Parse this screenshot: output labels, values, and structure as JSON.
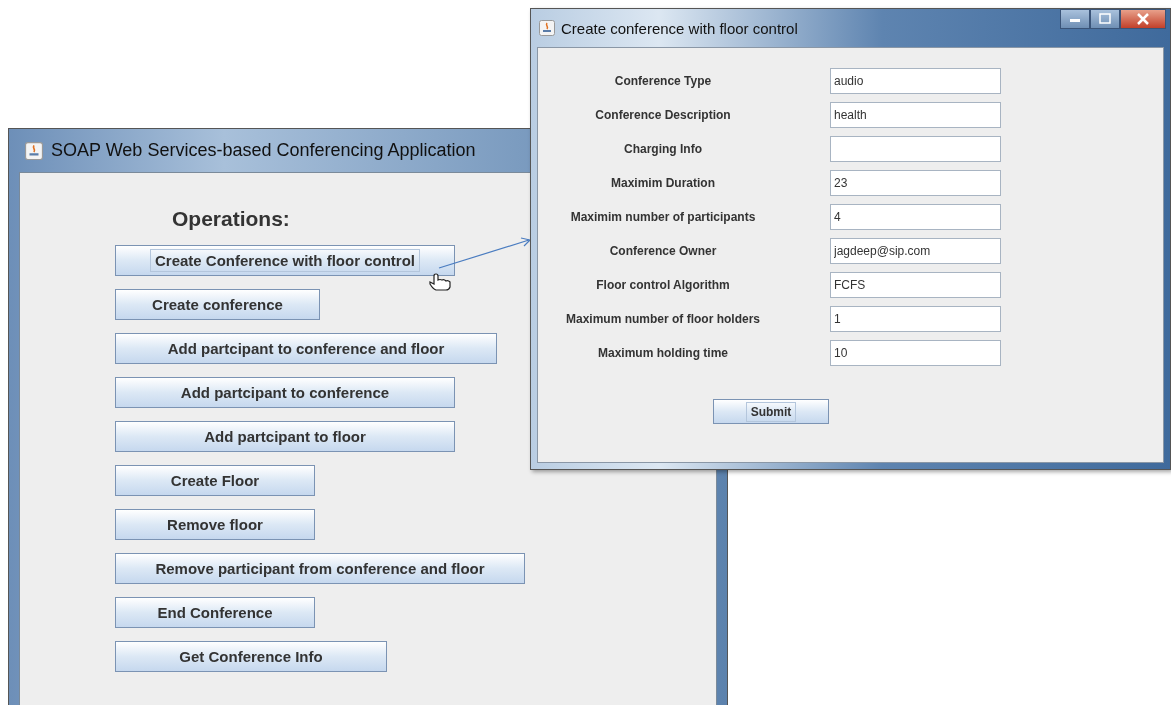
{
  "main_window": {
    "title": "SOAP Web Services-based Conferencing Application",
    "heading": "Operations:",
    "buttons": [
      {
        "label": "Create Conference with floor control",
        "focused": true
      },
      {
        "label": "Create conference",
        "focused": false
      },
      {
        "label": "Add partcipant to conference and floor",
        "focused": false
      },
      {
        "label": "Add partcipant to conference",
        "focused": false
      },
      {
        "label": "Add partcipant to floor",
        "focused": false
      },
      {
        "label": "Create Floor",
        "focused": false
      },
      {
        "label": "Remove floor",
        "focused": false
      },
      {
        "label": "Remove participant from conference and floor",
        "focused": false
      },
      {
        "label": "End Conference",
        "focused": false
      },
      {
        "label": "Get Conference Info",
        "focused": false
      }
    ]
  },
  "dialog": {
    "title": "Create conference with floor control",
    "fields": [
      {
        "label": "Conference Type",
        "value": "audio"
      },
      {
        "label": "Conference Description",
        "value": "health"
      },
      {
        "label": "Charging Info"
      },
      {
        "label": "Maximim Duration",
        "value": "23"
      },
      {
        "label": "Maximim number of participants",
        "value": "4"
      },
      {
        "label": "Conference Owner",
        "value": "jagdeep@sip.com"
      },
      {
        "label": "Floor control Algorithm",
        "value": "FCFS"
      },
      {
        "label": "Maximum number of floor holders",
        "value": "1"
      },
      {
        "label": "Maximum holding time",
        "value": "10"
      }
    ],
    "submit": {
      "label": "Submit",
      "focused": true
    }
  }
}
